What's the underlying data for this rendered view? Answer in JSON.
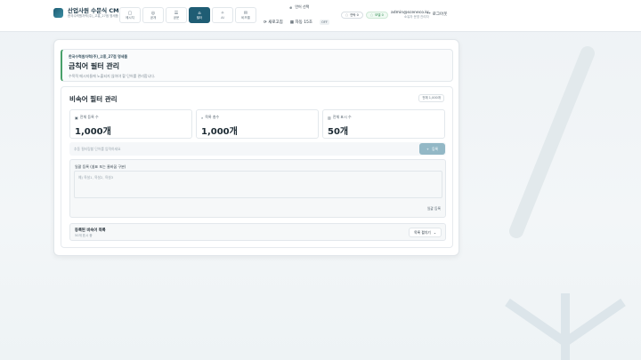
{
  "header": {
    "brand_title": "산업사원 수문식 CMS",
    "brand_sub": "한국수력원자력(주)_고흥_27점 명세품",
    "nav": [
      {
        "label": "메시지",
        "icon": "message-icon"
      },
      {
        "label": "공개",
        "icon": "broadcast-icon"
      },
      {
        "label": "공문",
        "icon": "document-icon"
      },
      {
        "label": "필터",
        "icon": "filter-icon"
      },
      {
        "label": "AI",
        "icon": "ai-icon"
      },
      {
        "label": "비즈멜",
        "icon": "mail-icon"
      }
    ],
    "active_nav": "필터",
    "lang_label": "언어 선택",
    "refresh_label": "새로고침",
    "autosave_label": "자동 15초",
    "autosave_state": "OFF",
    "pill1": "연락 0",
    "pill2": "모델 0",
    "user_email": "admin@sceneco.kr",
    "user_role": "소유자 운영 관리자",
    "logout_label": "로그아웃"
  },
  "page": {
    "org": "한국수력원자력(주)_고흥_27점 명세품",
    "title": "금칙어 필터 관리",
    "desc": "수목적 메시지들에 노출되지 않아야 할 단어를 관리합니다."
  },
  "section": {
    "title": "비속어 필터 관리",
    "badge": "전체 1,000개",
    "stats": [
      {
        "label": "전체 등록 수",
        "value": "1,000개",
        "icon": "calendar-icon"
      },
      {
        "label": "목록 총수",
        "value": "1,000개",
        "icon": "search-icon"
      },
      {
        "label": "전체 표시 수",
        "value": "50개",
        "icon": "chart-icon"
      }
    ],
    "add_placeholder": "추동 필터링할 단어를 입력하세요",
    "add_button": "등록",
    "bulk_label": "일괄 등록 (쉼표 또는 줄바꿈 구분)",
    "bulk_placeholder": "예) 욕설1, 욕설2, 욕설3",
    "bulk_button": "일괄 등록",
    "list_title": "등록된 비속어 목록",
    "list_sub": "50개 표시 중",
    "list_toggle": "목록 펼치기"
  },
  "colors": {
    "accent": "#1f5d74",
    "add_button": "#93b8c6",
    "success": "#2e8b50"
  }
}
